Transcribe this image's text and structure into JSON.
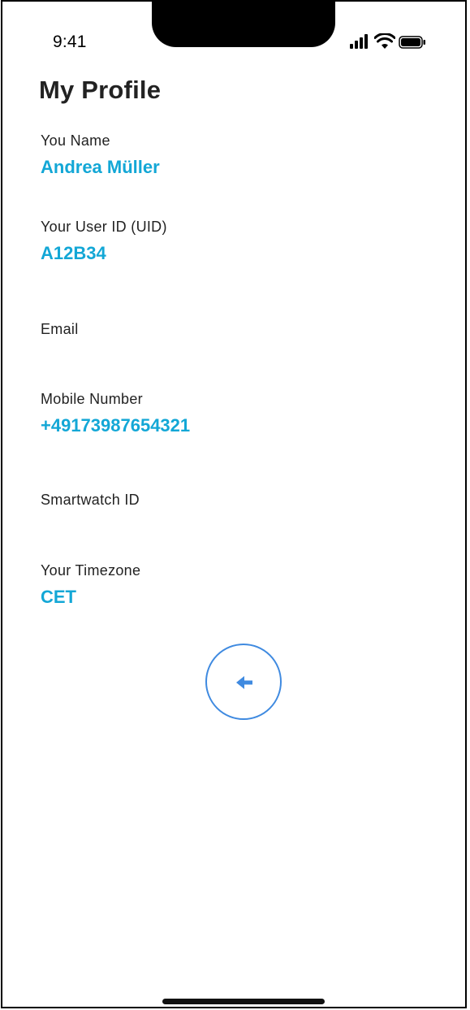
{
  "status_bar": {
    "time": "9:41",
    "icons": [
      "signal-icon",
      "wifi-icon",
      "battery-icon"
    ]
  },
  "header": {
    "title": "My Profile"
  },
  "profile": {
    "name_label": "You Name",
    "name_value": "Andrea Müller",
    "uid_label": "Your User ID (UID)",
    "uid_value": "A12B34",
    "email_label": "Email",
    "email_value": "",
    "mobile_label": "Mobile Number",
    "mobile_value": "+49173987654321",
    "smartwatch_label": "Smartwatch ID",
    "smartwatch_value": "",
    "timezone_label": "Your Timezone",
    "timezone_value": "CET"
  },
  "footer": {
    "back_icon": "arrow-left-icon"
  },
  "colors": {
    "accent": "#13a7d6",
    "button_ring": "#3f8ae0",
    "text": "#222222"
  }
}
